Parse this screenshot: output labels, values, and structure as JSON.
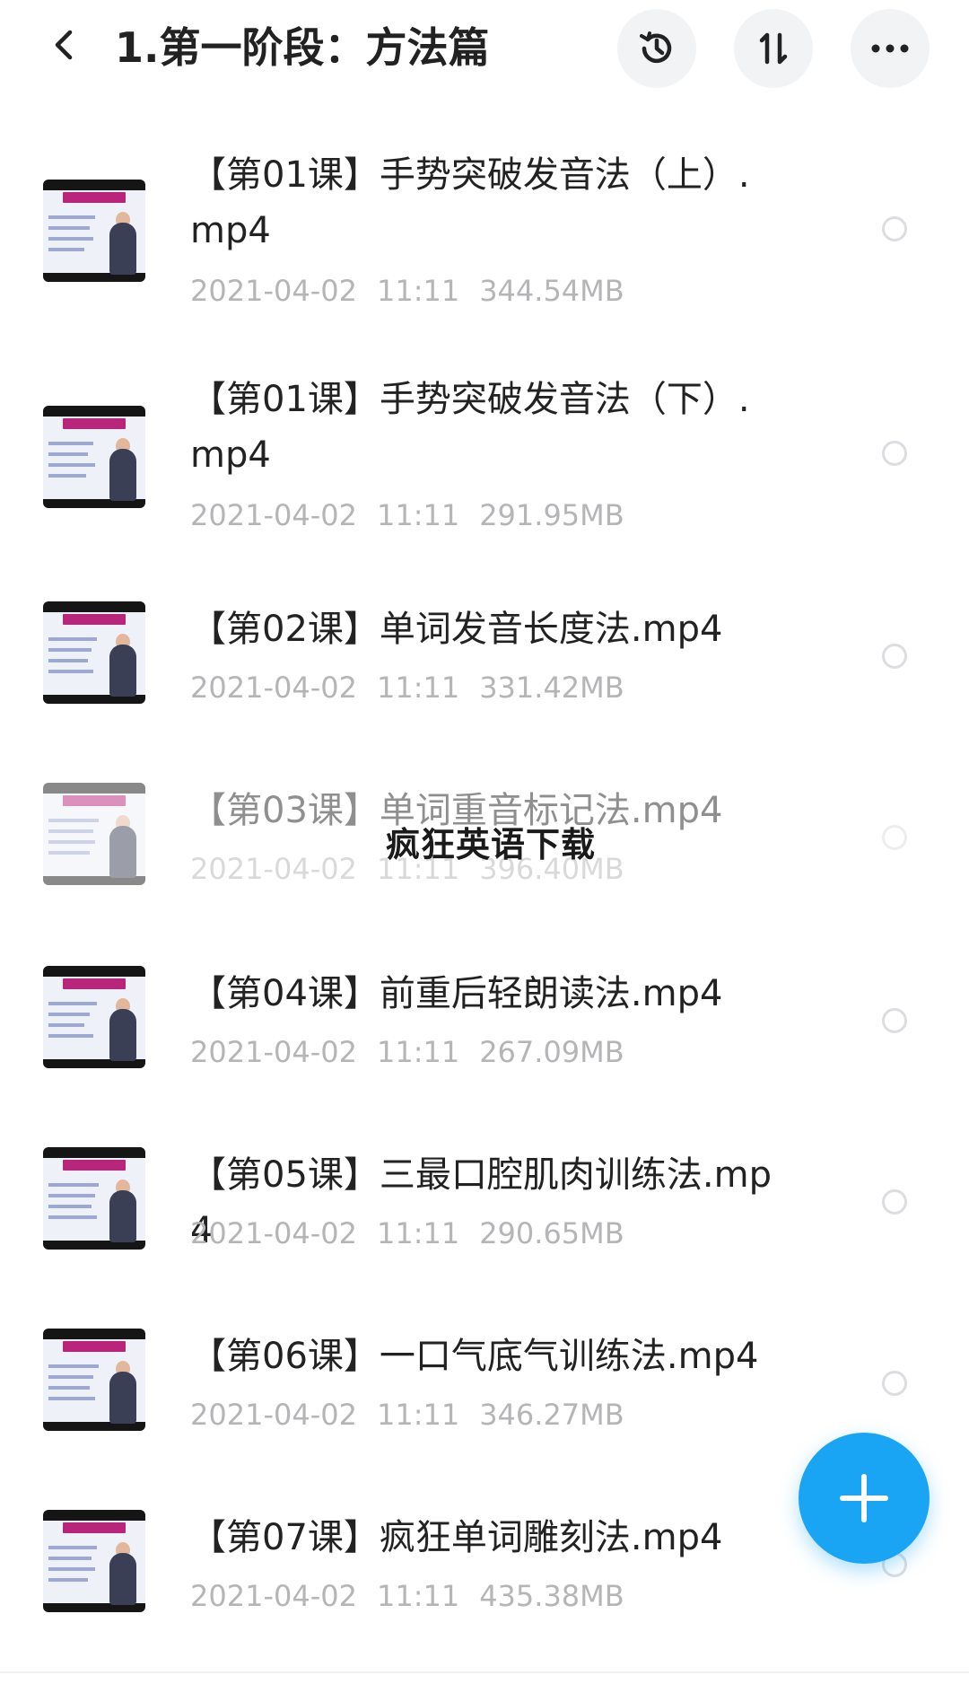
{
  "header": {
    "title": "1.第一阶段：方法篇",
    "back_icon": "chevron-left-icon",
    "history_icon": "history-icon",
    "sort_icon": "sort-icon",
    "more_icon": "more-icon"
  },
  "files": [
    {
      "name": "【第01课】手势突破发音法（上）.mp4",
      "date": "2021-04-02",
      "time": "11:11",
      "size": "344.54MB"
    },
    {
      "name": "【第01课】手势突破发音法（下）.mp4",
      "date": "2021-04-02",
      "time": "11:11",
      "size": "291.95MB"
    },
    {
      "name": "【第02课】单词发音长度法.mp4",
      "date": "2021-04-02",
      "time": "11:11",
      "size": "331.42MB"
    },
    {
      "name": "【第03课】单词重音标记法.mp4",
      "date": "2021-04-02",
      "time": "11:11",
      "size": "396.40MB"
    },
    {
      "name": "【第04课】前重后轻朗读法.mp4",
      "date": "2021-04-02",
      "time": "11:11",
      "size": "267.09MB"
    },
    {
      "name": "【第05课】三最口腔肌肉训练法.mp4",
      "date": "2021-04-02",
      "time": "11:11",
      "size": "290.65MB"
    },
    {
      "name": "【第06课】一口气底气训练法.mp4",
      "date": "2021-04-02",
      "time": "11:11",
      "size": "346.27MB"
    },
    {
      "name": "【第07课】疯狂单词雕刻法.mp4",
      "date": "2021-04-02",
      "time": "11:11",
      "size": "435.38MB"
    }
  ],
  "watermark": "疯狂英语下载",
  "fab": {
    "icon": "plus-icon"
  },
  "colors": {
    "accent": "#1aa4f4",
    "meta": "#b5b5b8"
  }
}
